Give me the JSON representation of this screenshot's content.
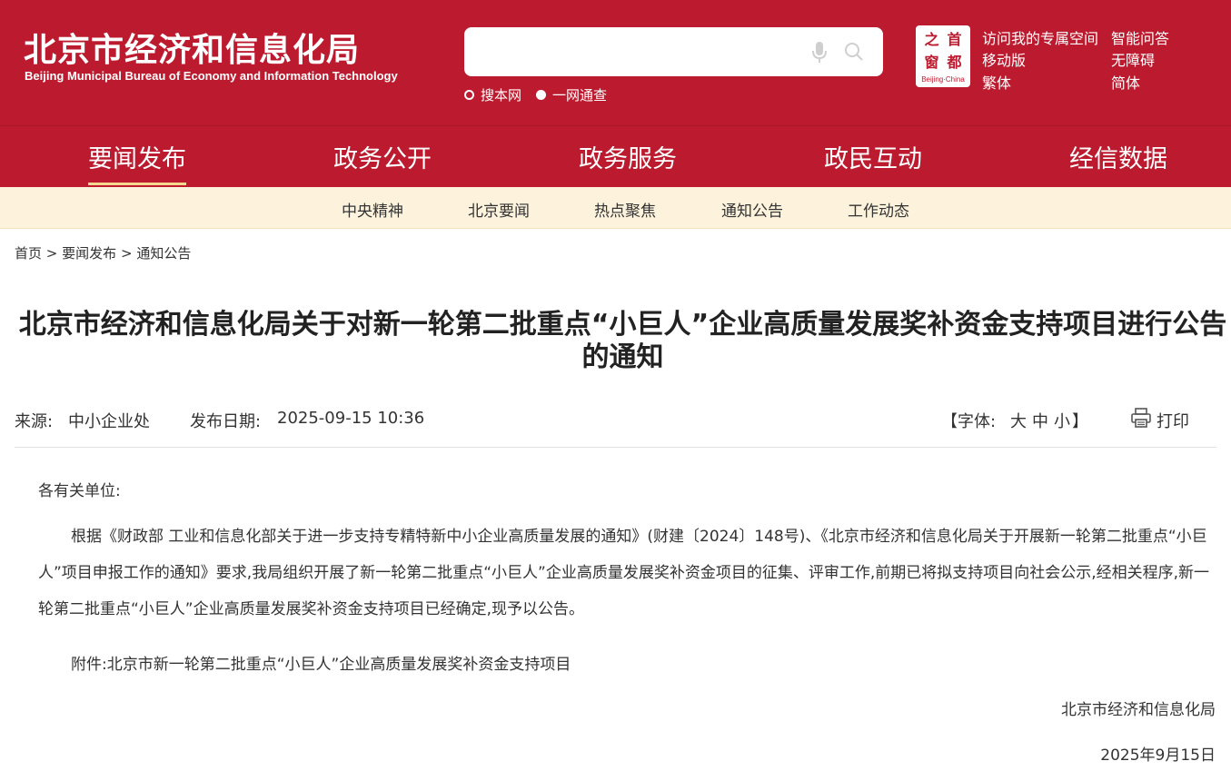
{
  "header": {
    "title_cn": "北京市经济和信息化局",
    "title_en": "Beijing Municipal Bureau of Economy and Information Technology",
    "search": {
      "placeholder": "",
      "options": [
        "搜本网",
        "一网通查"
      ],
      "selected": "一网通查",
      "mic_icon": "microphone-icon",
      "search_icon": "search-icon"
    },
    "seal": {
      "chars": [
        "之",
        "首",
        "窗",
        "都"
      ],
      "caption": "Beijing·China"
    },
    "links": [
      "访问我的专属空间",
      "智能问答",
      "移动版",
      "无障碍",
      "繁体",
      "简体"
    ],
    "colors": {
      "brand_red": "#bc1a2e",
      "subnav_bg": "#fdf3dc",
      "active_underline": "#f5d68f"
    }
  },
  "nav": {
    "items": [
      "要闻发布",
      "政务公开",
      "政务服务",
      "政民互动",
      "经信数据"
    ],
    "active": "要闻发布"
  },
  "subnav": {
    "items": [
      "中央精神",
      "北京要闻",
      "热点聚焦",
      "通知公告",
      "工作动态"
    ]
  },
  "breadcrumb": {
    "items": [
      "首页",
      "要闻发布",
      "通知公告"
    ],
    "separator": ">"
  },
  "article": {
    "title": "北京市经济和信息化局关于对新一轮第二批重点“小巨人”企业高质量发展奖补资金支持项目进行公告的通知",
    "source_label": "来源:",
    "source": "中小企业处",
    "date_label": "发布日期:",
    "date": "2025-09-15 10:36",
    "font_label": "【字体:",
    "font_sizes": [
      "大",
      "中",
      "小"
    ],
    "font_end": "】",
    "print_label": "打印",
    "print_icon": "printer-icon",
    "salutation": "各有关单位:",
    "body": "根据《财政部 工业和信息化部关于进一步支持专精特新中小企业高质量发展的通知》(财建〔2024〕148号)、《北京市经济和信息化局关于开展新一轮第二批重点“小巨人”项目申报工作的通知》要求,我局组织开展了新一轮第二批重点“小巨人”企业高质量发展奖补资金项目的征集、评审工作,前期已将拟支持项目向社会公示,经相关程序,新一轮第二批重点“小巨人”企业高质量发展奖补资金支持项目已经确定,现予以公告。",
    "attachment": "附件:北京市新一轮第二批重点“小巨人”企业高质量发展奖补资金支持项目",
    "signature": "北京市经济和信息化局",
    "sign_date": "2025年9月15日"
  }
}
